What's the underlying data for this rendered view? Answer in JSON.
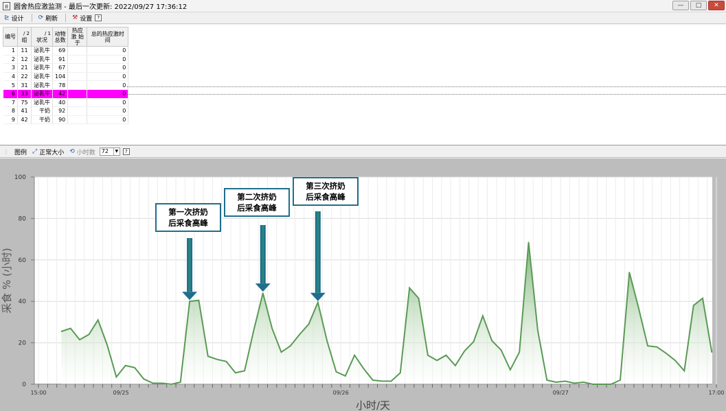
{
  "window": {
    "title": "圆舍热应激监测 - 最后一次更新: 2022/09/27 17:36:12",
    "controls": [
      "—",
      "□",
      "✕"
    ]
  },
  "toolbar": {
    "design_label": "设计",
    "refresh_label": "刷新",
    "settings_label": "设置",
    "help_label": "?"
  },
  "table": {
    "headers": [
      "编号",
      "组",
      "状况",
      "动物总数",
      "热应激 始于",
      "总的热应激时间"
    ],
    "sort_markers": [
      "/ 2",
      "/ 1"
    ],
    "rows": [
      [
        "1",
        "11",
        "泌乳牛",
        "69",
        "",
        "0"
      ],
      [
        "2",
        "12",
        "泌乳牛",
        "91",
        "",
        "0"
      ],
      [
        "3",
        "21",
        "泌乳牛",
        "67",
        "",
        "0"
      ],
      [
        "4",
        "22",
        "泌乳牛",
        "104",
        "",
        "0"
      ],
      [
        "5",
        "31",
        "泌乳牛",
        "78",
        "",
        "0"
      ],
      [
        "6",
        "33",
        "泌乳牛",
        "42",
        "",
        "0"
      ],
      [
        "7",
        "75",
        "泌乳牛",
        "40",
        "",
        "0"
      ],
      [
        "8",
        "41",
        "干奶",
        "92",
        "",
        "0"
      ],
      [
        "9",
        "42",
        "干奶",
        "90",
        "",
        "0"
      ]
    ],
    "selected_row": 6,
    "selected_color": "#ff00ff"
  },
  "chart_toolbar": {
    "legend_label": "图例",
    "normal_size_label": "正常大小",
    "hours_label": "小时数",
    "hours_value": "72",
    "help_label": "?"
  },
  "chart_data": {
    "type": "area",
    "ylabel": "采食 % (小时)",
    "xlabel": "小时/天",
    "ylim": [
      0,
      100
    ],
    "yticks": [
      0,
      20,
      40,
      60,
      80,
      100
    ],
    "x_tick_labels": [
      "15:00",
      "09/25",
      "09/26",
      "09/27",
      "17:00"
    ],
    "x_tick_hours": [
      0,
      9,
      33,
      57,
      74
    ],
    "xlim_hours": [
      0,
      74
    ],
    "grid": true,
    "series": [
      {
        "values": [
          25.5,
          27,
          21.5,
          24,
          31,
          19,
          3.5,
          9,
          8,
          2.5,
          0.5,
          0.5,
          0,
          1,
          40,
          40.5,
          13.5,
          12,
          11,
          5.5,
          6.5,
          26,
          44,
          27,
          15.5,
          18.5,
          24,
          29,
          39.5,
          21,
          6,
          4,
          14,
          7.5,
          2,
          1.5,
          1.5,
          5.5,
          46.5,
          41.5,
          14,
          11.5,
          14,
          9,
          16,
          20.5,
          33,
          21,
          16.5,
          7,
          15.5,
          68.5,
          26,
          2,
          1,
          1.5,
          0.5,
          1,
          0,
          0,
          0,
          2,
          54,
          37,
          18.5,
          18,
          15,
          11.5,
          6.5,
          38,
          41.5,
          15.5
        ],
        "start_hour": 2.5,
        "step_hours": 1
      }
    ],
    "line_color": "#5a9a55",
    "fill_top_color": "#6cac64",
    "annotations": [
      {
        "text_line1": "第一次挤奶",
        "text_line2": "后采食高峰",
        "target_value": 40
      },
      {
        "text_line1": "第二次挤奶",
        "text_line2": "后采食高峰",
        "target_value": 44
      },
      {
        "text_line1": "第三次挤奶",
        "text_line2": "后采食高峰",
        "target_value": 39.5
      }
    ],
    "arrow_color": "#1f6e8c"
  }
}
